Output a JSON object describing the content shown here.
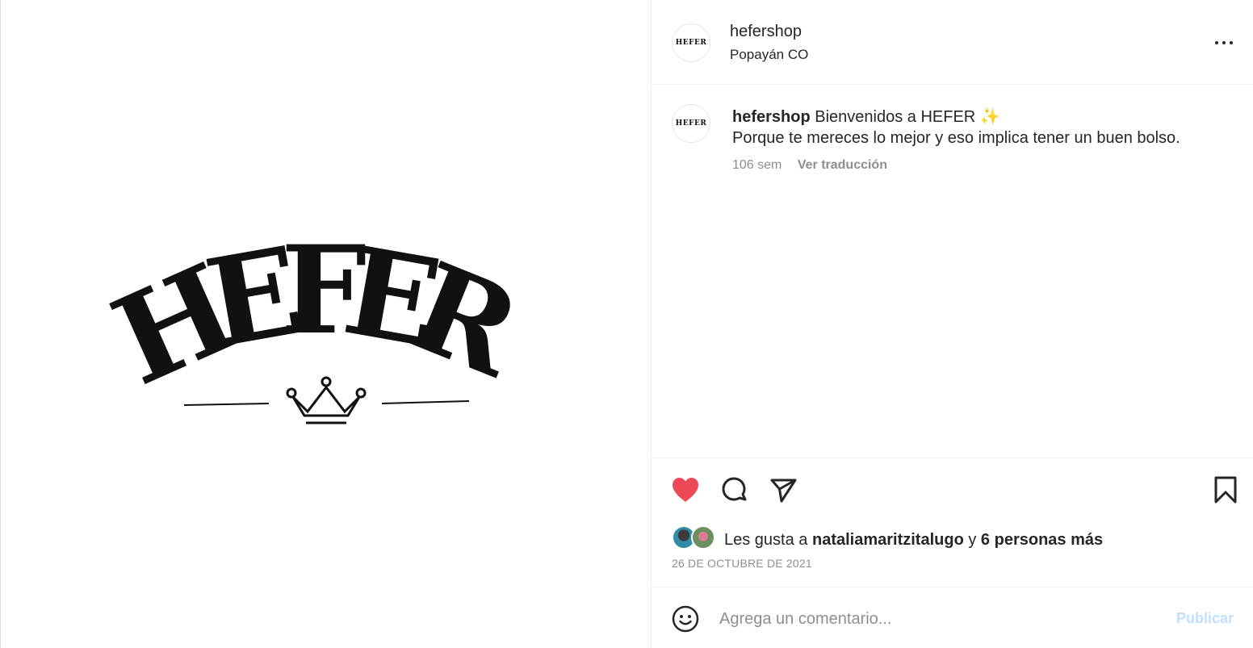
{
  "media": {
    "logo_text": "HEFER",
    "logo_letters": [
      "H",
      "E",
      "F",
      "E",
      "R"
    ]
  },
  "header": {
    "username": "hefershop",
    "location": "Popayán CO",
    "avatar_text": "HEFER"
  },
  "caption": {
    "username": "hefershop",
    "text_line1": "Bienvenidos a HEFER",
    "emoji": "✨",
    "text_line2": "Porque te mereces lo mejor y eso implica tener un buen bolso.",
    "age": "106 sem",
    "translate_label": "Ver traducción"
  },
  "likes": {
    "prefix": "Les gusta a",
    "user": "nataliamaritzitalugo",
    "joiner": "y",
    "others": "6 personas más"
  },
  "date": "26 DE OCTUBRE DE 2021",
  "comment": {
    "placeholder": "Agrega un comentario...",
    "publish_label": "Publicar"
  },
  "colors": {
    "like_red": "#ed4956",
    "publish_disabled": "#c0dffd",
    "muted_text": "#8e8e8e",
    "text": "#262626"
  }
}
